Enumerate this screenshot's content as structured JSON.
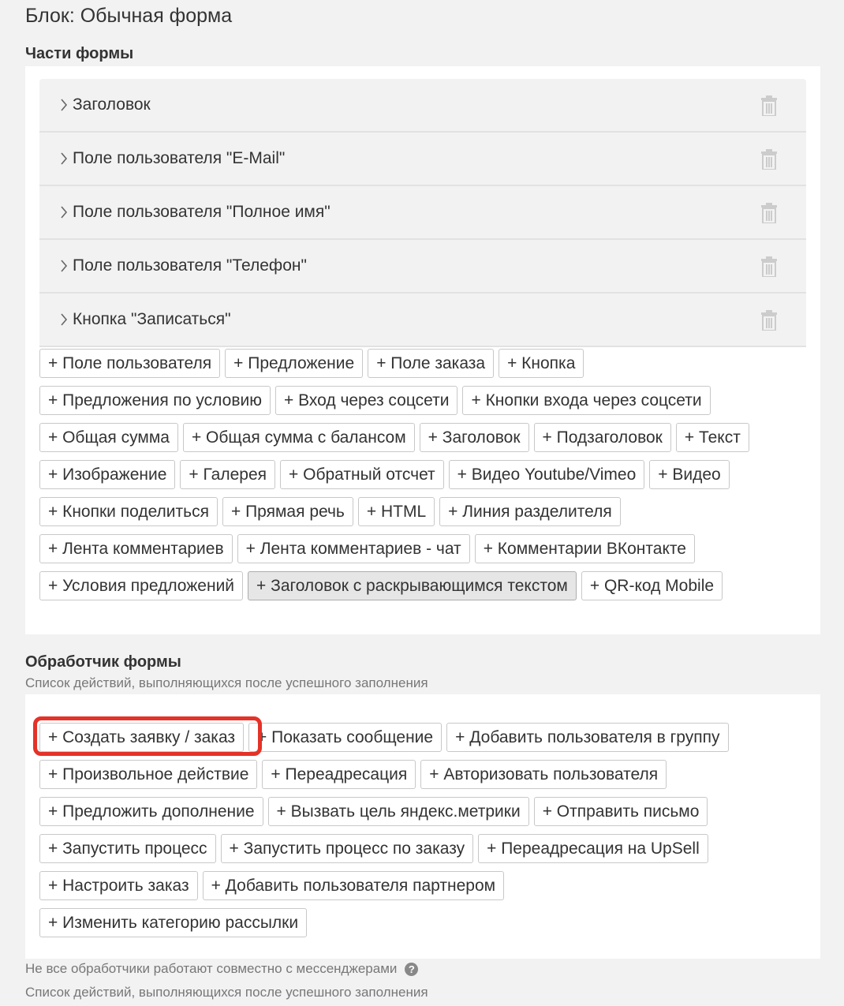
{
  "page_title": "Блок: Обычная форма",
  "parts_section": {
    "title": "Части формы",
    "items": [
      {
        "label": "Заголовок"
      },
      {
        "label": "Поле пользователя \"E-Mail\""
      },
      {
        "label": "Поле пользователя \"Полное имя\""
      },
      {
        "label": "Поле пользователя \"Телефон\""
      },
      {
        "label": "Кнопка \"Записаться\""
      }
    ],
    "add_buttons": [
      [
        "+ Поле пользователя",
        "+ Предложение",
        "+ Поле заказа",
        "+ Кнопка"
      ],
      [
        "+ Предложения по условию",
        "+ Вход через соцсети",
        "+ Кнопки входа через соцсети"
      ],
      [
        "+ Общая сумма",
        "+ Общая сумма с балансом",
        "+ Заголовок",
        "+ Подзаголовок",
        "+ Текст"
      ],
      [
        "+ Изображение",
        "+ Галерея",
        "+ Обратный отсчет",
        "+ Видео Youtube/Vimeo",
        "+ Видео"
      ],
      [
        "+ Кнопки поделиться",
        "+ Прямая речь",
        "+ HTML",
        "+ Линия разделителя"
      ],
      [
        "+ Лента комментариев",
        "+ Лента комментариев - чат",
        "+ Комментарии ВКонтакте"
      ],
      [
        "+ Условия предложений",
        "+ Заголовок с раскрывающимся текстом",
        "+ QR-код Mobile"
      ]
    ],
    "hovered_button": "+ Заголовок с раскрывающимся текстом"
  },
  "handler_section": {
    "title": "Обработчик формы",
    "subtitle": "Список действий, выполняющихся после успешного заполнения",
    "add_buttons": [
      [
        "+ Создать заявку / заказ",
        "+ Показать сообщение",
        "+ Добавить пользователя в группу"
      ],
      [
        "+ Произвольное действие",
        "+ Переадресация",
        "+ Авторизовать пользователя"
      ],
      [
        "+ Предложить дополнение",
        "+ Вызвать цель яндекс.метрики",
        "+ Отправить письмо"
      ],
      [
        "+ Запустить процесс",
        "+ Запустить процесс по заказу",
        "+ Переадресация на UpSell"
      ],
      [
        "+ Настроить заказ",
        "+ Добавить пользователя партнером"
      ],
      [
        "+ Изменить категорию рассылки"
      ]
    ],
    "highlighted_button": "+ Создать заявку / заказ",
    "highlight_color": "#e53228"
  },
  "footer": {
    "note": "Не все обработчики работают совместно с мессенджерами",
    "help_icon_glyph": "?",
    "subtitle": "Список действий, выполняющихся после успешного заполнения"
  }
}
